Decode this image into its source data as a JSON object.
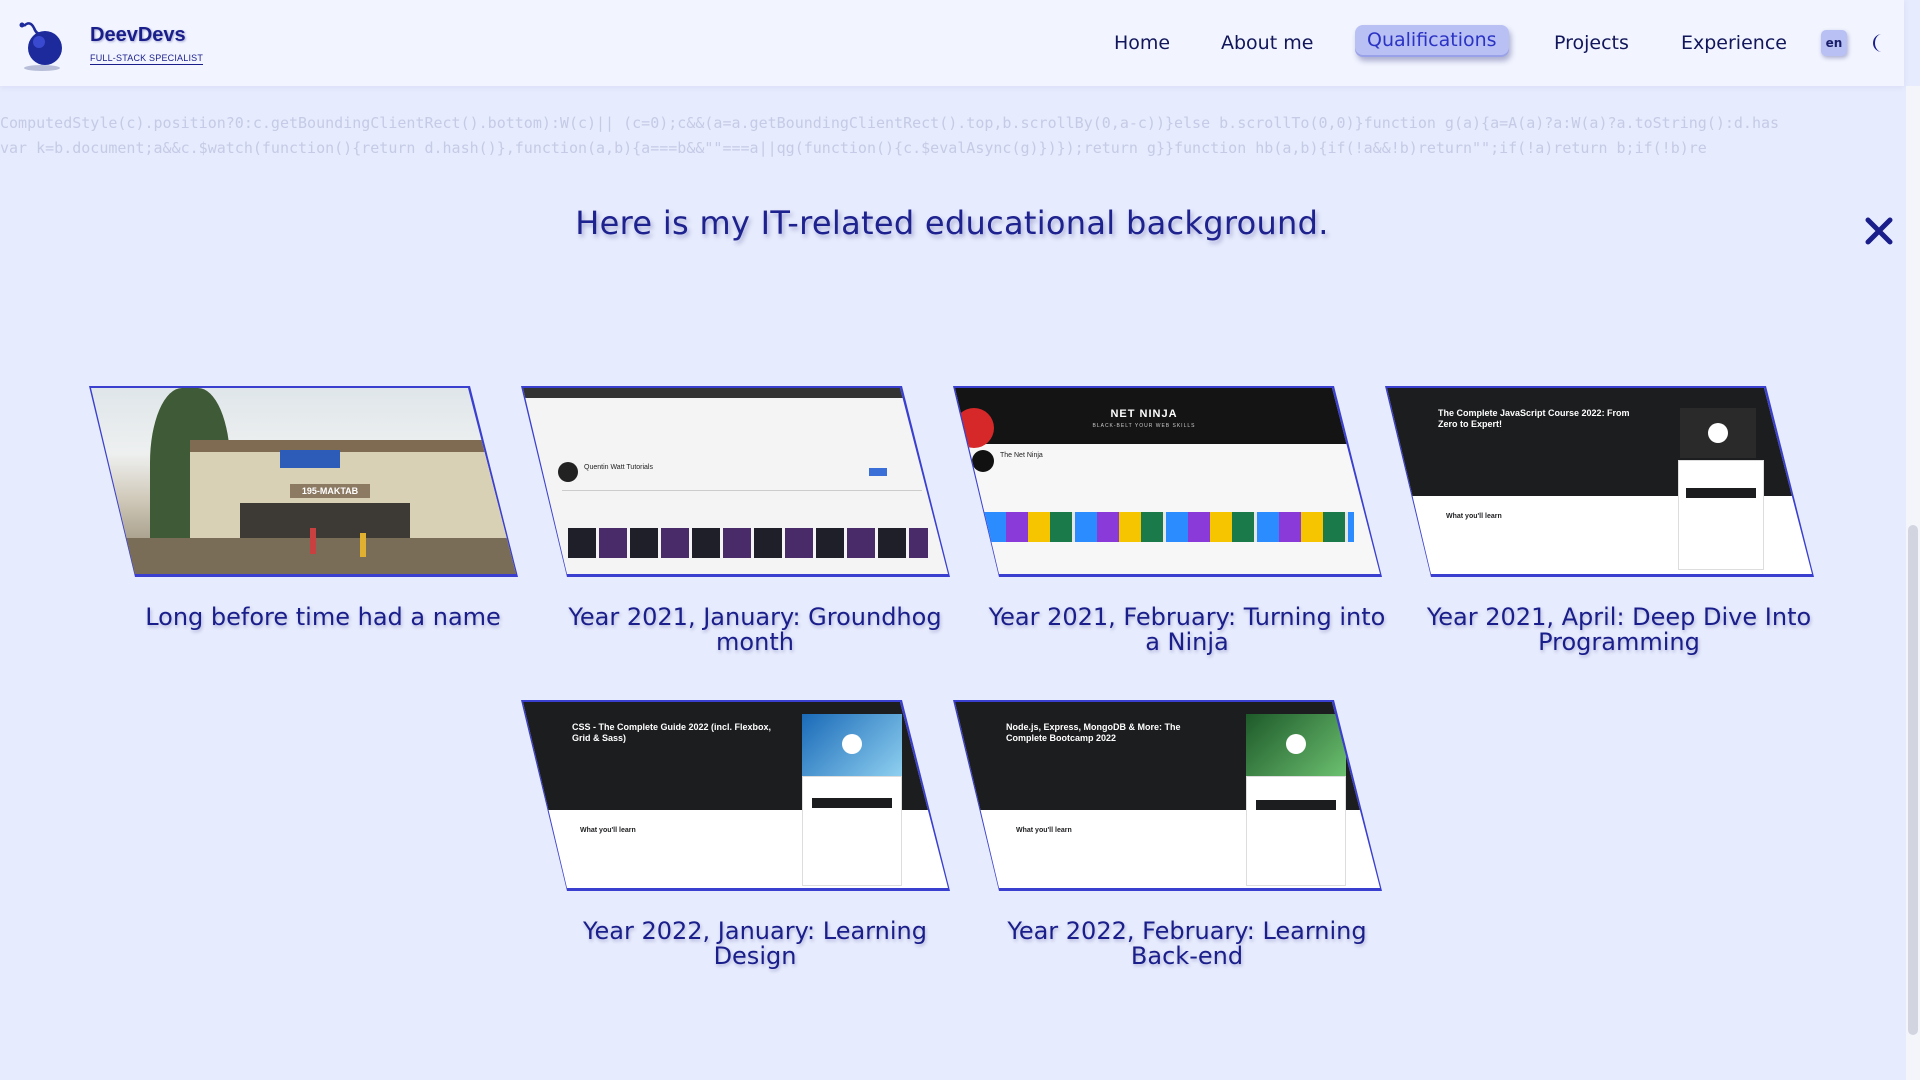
{
  "header": {
    "brand_name": "DeevDevs",
    "brand_tagline": "FULL-STACK SPECIALIST",
    "nav": [
      {
        "label": "Home",
        "active": false
      },
      {
        "label": "About me",
        "active": false
      },
      {
        "label": "Qualifications",
        "active": true
      },
      {
        "label": "Projects",
        "active": false
      },
      {
        "label": "Experience",
        "active": false
      }
    ],
    "language": "en",
    "theme_icon": "moon-icon"
  },
  "background_code": [
    "ComputedStyle(c).position?0:c.getBoundingClientRect().bottom):W(c)|| (c=0);c&&(a=a.getBoundingClientRect().top,b.scrollBy(0,a-c))}else b.scrollTo(0,0)}function g(a){a=A(a)?a:W(a)?a.toString():d.has",
    "var k=b.document;a&&c.$watch(function(){return d.hash()},function(a,b){a===b&&\"\"===a||qg(function(){c.$evalAsync(g)})});return g}}function hb(a,b){if(!a&&!b)return\"\";if(!a)return b;if(!b)re"
  ],
  "heading": "Here is my IT-related educational background.",
  "close_icon": "close-icon",
  "cards": [
    {
      "title": "Long before time had a name",
      "thumb_kind": "school",
      "sign": "195-MAKTAB"
    },
    {
      "title": "Year 2021, January: Groundhog month",
      "thumb_kind": "youtube",
      "channel": "Quentin Watt Tutorials"
    },
    {
      "title": "Year 2021, February: Turning into a Ninja",
      "thumb_kind": "ninja",
      "banner_title": "NET NINJA",
      "banner_sub": "BLACK-BELT YOUR WEB SKILLS",
      "channel": "The Net Ninja"
    },
    {
      "title": "Year 2021, April: Deep Dive Into Programming",
      "thumb_kind": "udemy",
      "course": "The Complete JavaScript Course 2022: From Zero to Expert!",
      "learn_label": "What you'll learn"
    },
    {
      "title": "Year 2022, January: Learning Design",
      "thumb_kind": "udemy",
      "course": "CSS - The Complete Guide 2022 (incl. Flexbox, Grid & Sass)",
      "learn_label": "What you'll learn"
    },
    {
      "title": "Year 2022, February: Learning Back-end",
      "thumb_kind": "udemy",
      "course": "Node.js, Express, MongoDB & More: The Complete Bootcamp 2022",
      "learn_label": "What you'll learn"
    }
  ],
  "colors": {
    "background": "#e6ebfd",
    "header_bg": "#f2f5ff",
    "accent": "#2b33c5",
    "active_nav_bg": "#b9c0f3",
    "text": "#1a1e8a"
  }
}
